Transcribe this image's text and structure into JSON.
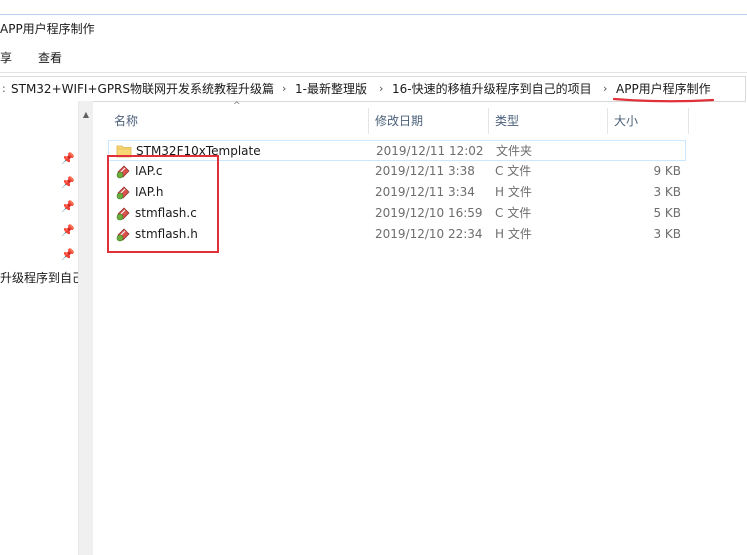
{
  "window": {
    "title": "APP用户程序制作"
  },
  "ribbon": {
    "share_label": "享",
    "view_label": "查看"
  },
  "address": {
    "crumbs": [
      "STM32+WIFI+GPRS物联网开发系统教程升级篇",
      "1-最新整理版",
      "16-快速的移植升级程序到自己的项目",
      "APP用户程序制作"
    ]
  },
  "navpane": {
    "truncated_item": "升级程序到自己"
  },
  "columns": {
    "name": "名称",
    "date": "修改日期",
    "type": "类型",
    "size": "大小"
  },
  "files": [
    {
      "name": "STM32F10xTemplate",
      "date": "2019/12/11 12:02",
      "type": "文件夹",
      "size": "",
      "icon": "folder-icon"
    },
    {
      "name": "IAP.c",
      "date": "2019/12/11 3:38",
      "type": "C 文件",
      "size": "9 KB",
      "icon": "c-source-file-icon"
    },
    {
      "name": "IAP.h",
      "date": "2019/12/11 3:34",
      "type": "H 文件",
      "size": "3 KB",
      "icon": "h-header-file-icon"
    },
    {
      "name": "stmflash.c",
      "date": "2019/12/10 16:59",
      "type": "C 文件",
      "size": "5 KB",
      "icon": "c-source-file-icon"
    },
    {
      "name": "stmflash.h",
      "date": "2019/12/10 22:34",
      "type": "H 文件",
      "size": "3 KB",
      "icon": "h-header-file-icon"
    }
  ],
  "colors": {
    "annotation_red": "#e0313a",
    "selection_border": "#cce8ff",
    "folder_yellow": "#f8d775"
  }
}
